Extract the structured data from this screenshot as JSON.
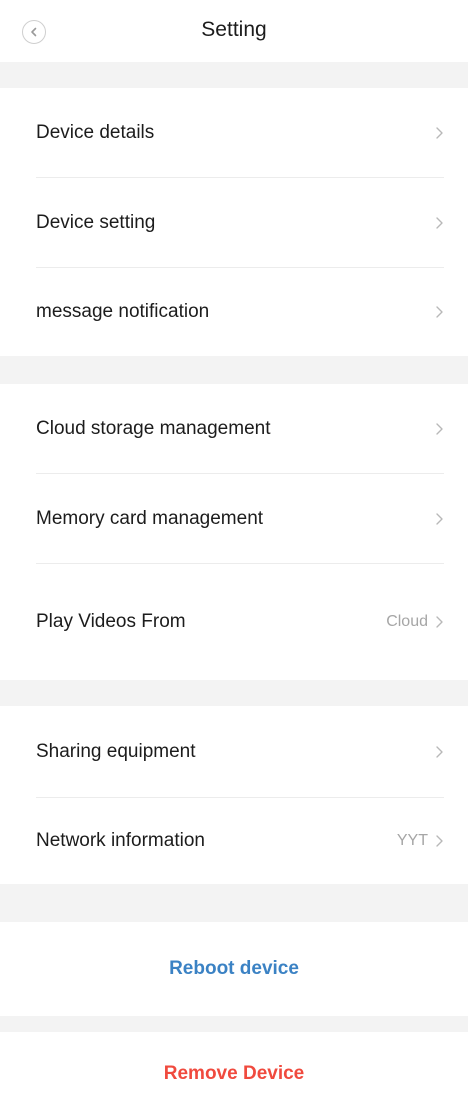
{
  "header": {
    "title": "Setting"
  },
  "groups": [
    {
      "items": [
        {
          "label": "Device details"
        },
        {
          "label": "Device setting"
        },
        {
          "label": "message notification"
        }
      ]
    },
    {
      "items": [
        {
          "label": "Cloud storage management"
        },
        {
          "label": "Memory card management"
        },
        {
          "label": "Play Videos From",
          "value": "Cloud"
        }
      ]
    },
    {
      "items": [
        {
          "label": "Sharing equipment"
        },
        {
          "label": "Network information",
          "value": "YYT"
        }
      ]
    }
  ],
  "actions": {
    "reboot_label": "Reboot device",
    "remove_label": "Remove Device"
  },
  "colors": {
    "reboot": "#3b82c4",
    "remove": "#f04a3e",
    "gap": "#f3f3f3"
  }
}
